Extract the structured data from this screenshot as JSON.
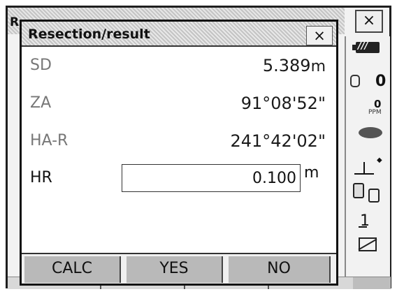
{
  "background_window": {
    "title_fragment": "R",
    "close_symbol": "×"
  },
  "dialog": {
    "title": "Resection/result",
    "close_symbol": "×",
    "rows": [
      {
        "label": "SD",
        "value": "5.389",
        "unit": "m"
      },
      {
        "label": "ZA",
        "value": "91°08'52\""
      },
      {
        "label": "HA-R",
        "value": "241°42'02\""
      }
    ],
    "hr": {
      "label": "HR",
      "value": "0.100",
      "unit": "m"
    },
    "softkeys": [
      "CALC",
      "YES",
      "NO"
    ]
  },
  "status_bar": {
    "battery_icon": "battery-icon",
    "battery_label": "///",
    "prism_constant": "0",
    "ppm_value": "0",
    "ppm_label": "PPM",
    "input_mode": "1"
  },
  "colors": {
    "label_gray": "#777777",
    "softkey_gray": "#b9b9b9",
    "frame": "#1e1e1e"
  }
}
